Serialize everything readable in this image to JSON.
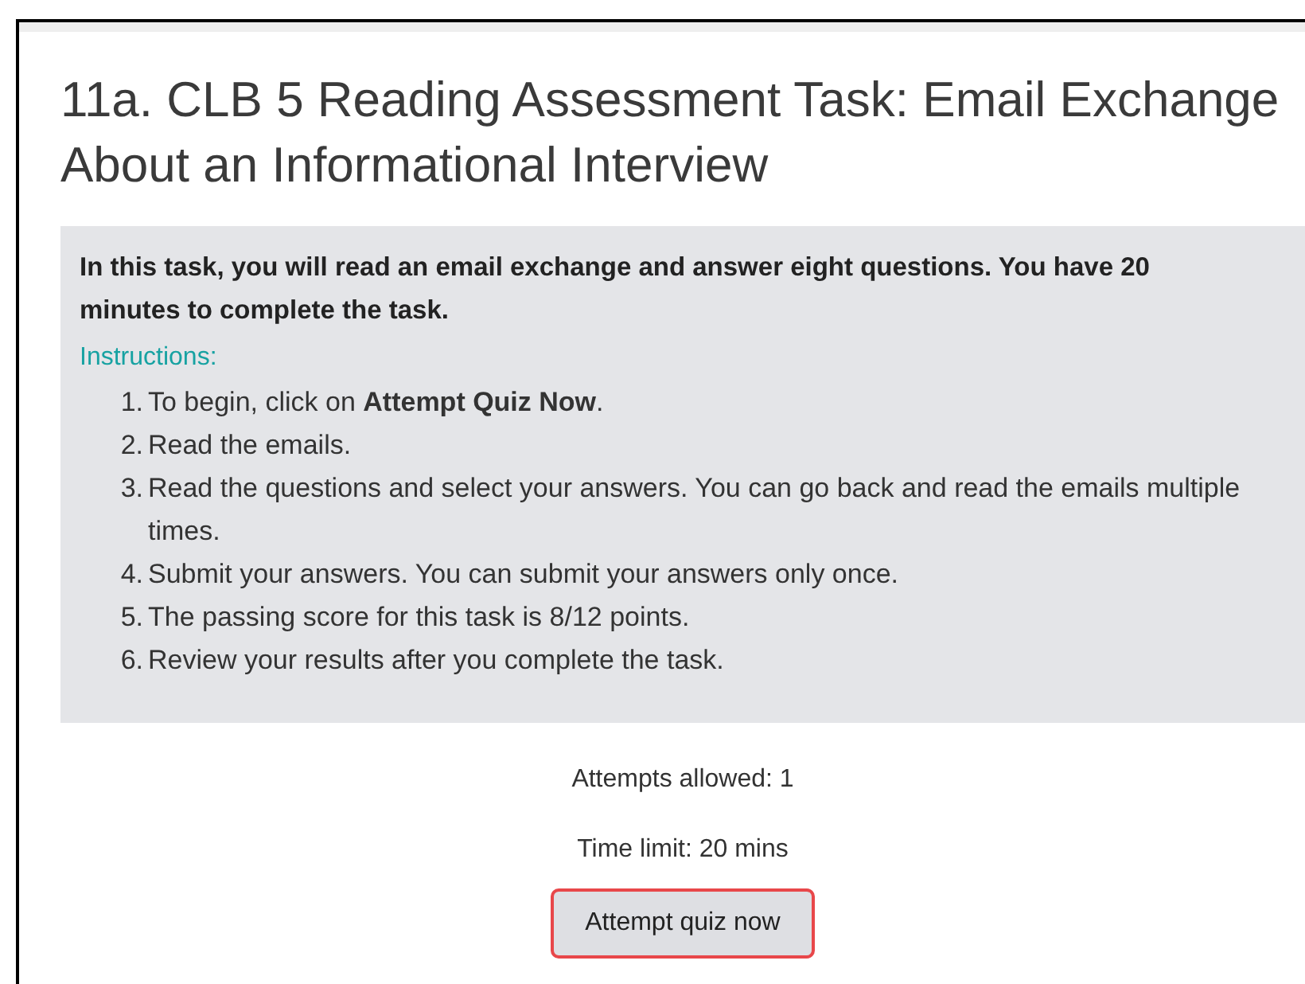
{
  "title": "11a. CLB 5 Reading Assessment Task: Email Exchange About an Informational Interview",
  "intro": {
    "lead": "In this task, you will read an email exchange and answer eight questions. You have 20 minutes to complete the task.",
    "instructions_heading": "Instructions:",
    "steps": [
      {
        "number": "1.",
        "text": "To begin, click on **Attempt Quiz Now**."
      },
      {
        "number": "2.",
        "text": "Read the emails."
      },
      {
        "number": "3.",
        "text": "Read the questions and select your answers. You can go back and read the emails multiple times."
      },
      {
        "number": "4.",
        "text": "Submit your answers. You can submit your answers only once."
      },
      {
        "number": "5.",
        "text": "The passing score for this task is 8/12 points."
      },
      {
        "number": "6.",
        "text": "Review your results after you complete the task."
      }
    ]
  },
  "quiz_info": [
    "Attempts allowed: 1",
    "Time limit: 20 mins"
  ],
  "attempt_button": {
    "label": "Attempt quiz now",
    "highlighted": true
  }
}
